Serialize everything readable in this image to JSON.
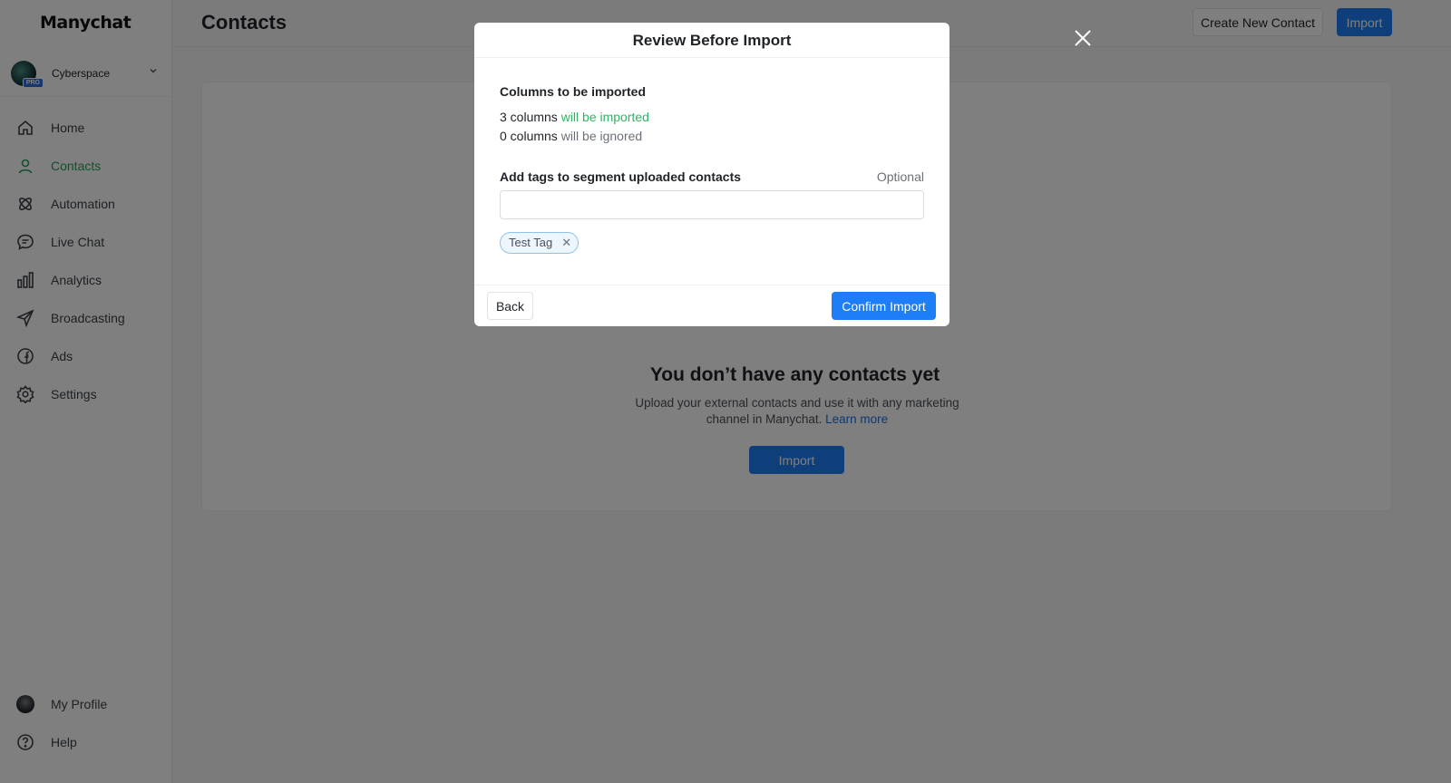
{
  "app": {
    "logo": "Manychat"
  },
  "account": {
    "name": "Cyberspace",
    "badge": "PRO"
  },
  "nav": {
    "items": [
      {
        "label": "Home",
        "icon": "home-icon"
      },
      {
        "label": "Contacts",
        "icon": "user-icon"
      },
      {
        "label": "Automation",
        "icon": "automation-icon"
      },
      {
        "label": "Live Chat",
        "icon": "chat-icon"
      },
      {
        "label": "Analytics",
        "icon": "bar-chart-icon"
      },
      {
        "label": "Broadcasting",
        "icon": "send-icon"
      },
      {
        "label": "Ads",
        "icon": "facebook-icon"
      },
      {
        "label": "Settings",
        "icon": "gear-icon"
      }
    ],
    "bottom": [
      {
        "label": "My Profile",
        "icon": "avatar"
      },
      {
        "label": "Help",
        "icon": "help-icon"
      }
    ],
    "active_color": "#25a35a"
  },
  "header": {
    "title": "Contacts",
    "create_label": "Create New Contact",
    "import_label": "Import"
  },
  "empty_state": {
    "title": "You don’t have any contacts yet",
    "desc": "Upload your external contacts and use it with any marketing channel in Manychat.",
    "link": "Learn more",
    "import_label": "Import"
  },
  "modal": {
    "title": "Review Before Import",
    "columns_title": "Columns to be imported",
    "imported_count": "3 columns",
    "imported_text": "will be imported",
    "ignored_count": "0 columns",
    "ignored_text": "will be ignored",
    "tags_title": "Add tags to segment uploaded contacts",
    "optional_label": "Optional",
    "tag_input_value": "",
    "tags": [
      "Test Tag"
    ],
    "back_label": "Back",
    "confirm_label": "Confirm Import"
  },
  "colors": {
    "primary": "#1d7ef7",
    "success": "#2fb465",
    "overlay": "rgba(0,0,0,0.5)"
  }
}
